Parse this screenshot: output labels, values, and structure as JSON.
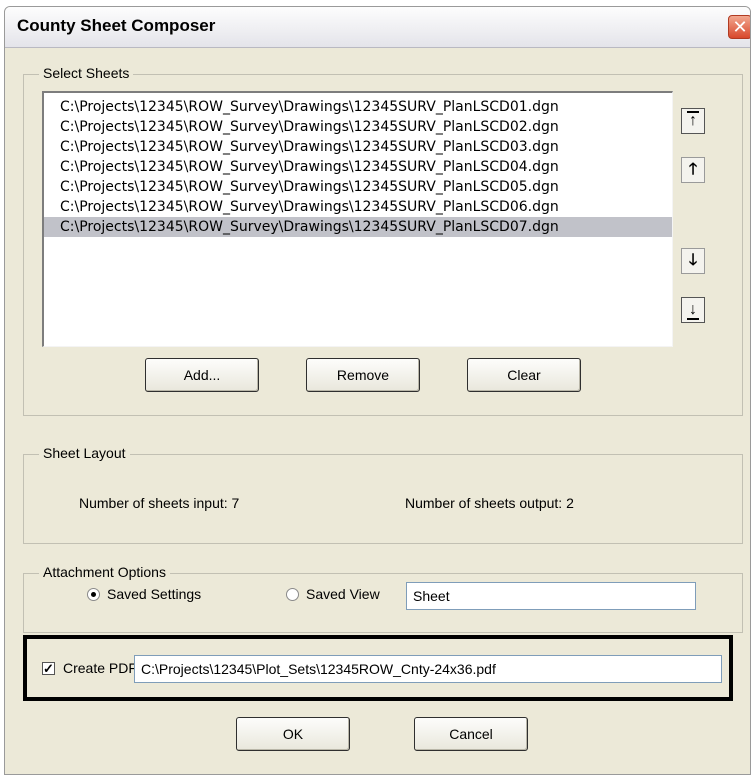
{
  "window": {
    "title": "County Sheet Composer",
    "close_glyph": "✕"
  },
  "select_sheets": {
    "legend": "Select Sheets",
    "files": [
      "C:\\Projects\\12345\\ROW_Survey\\Drawings\\12345SURV_PlanLSCD01.dgn",
      "C:\\Projects\\12345\\ROW_Survey\\Drawings\\12345SURV_PlanLSCD02.dgn",
      "C:\\Projects\\12345\\ROW_Survey\\Drawings\\12345SURV_PlanLSCD03.dgn",
      "C:\\Projects\\12345\\ROW_Survey\\Drawings\\12345SURV_PlanLSCD04.dgn",
      "C:\\Projects\\12345\\ROW_Survey\\Drawings\\12345SURV_PlanLSCD05.dgn",
      "C:\\Projects\\12345\\ROW_Survey\\Drawings\\12345SURV_PlanLSCD06.dgn",
      "C:\\Projects\\12345\\ROW_Survey\\Drawings\\12345SURV_PlanLSCD07.dgn"
    ],
    "selected_index": 6,
    "buttons": {
      "add": "Add...",
      "remove": "Remove",
      "clear": "Clear"
    },
    "move_icons": [
      "move-to-top-icon",
      "move-up-icon",
      "move-down-icon",
      "move-to-bottom-icon"
    ]
  },
  "sheet_layout": {
    "legend": "Sheet Layout",
    "input_text": "Number of sheets input: 7",
    "output_text": "Number of sheets output: 2"
  },
  "attachment": {
    "legend": "Attachment Options",
    "saved_settings_label": "Saved Settings",
    "saved_view_label": "Saved View",
    "saved_view_value": "Sheet",
    "selected_option": "Saved Settings"
  },
  "pdf": {
    "checked": true,
    "label": "Create PDF",
    "path": "C:\\Projects\\12345\\Plot_Sets\\12345ROW_Cnty-24x36.pdf"
  },
  "footer": {
    "ok": "OK",
    "cancel": "Cancel"
  }
}
